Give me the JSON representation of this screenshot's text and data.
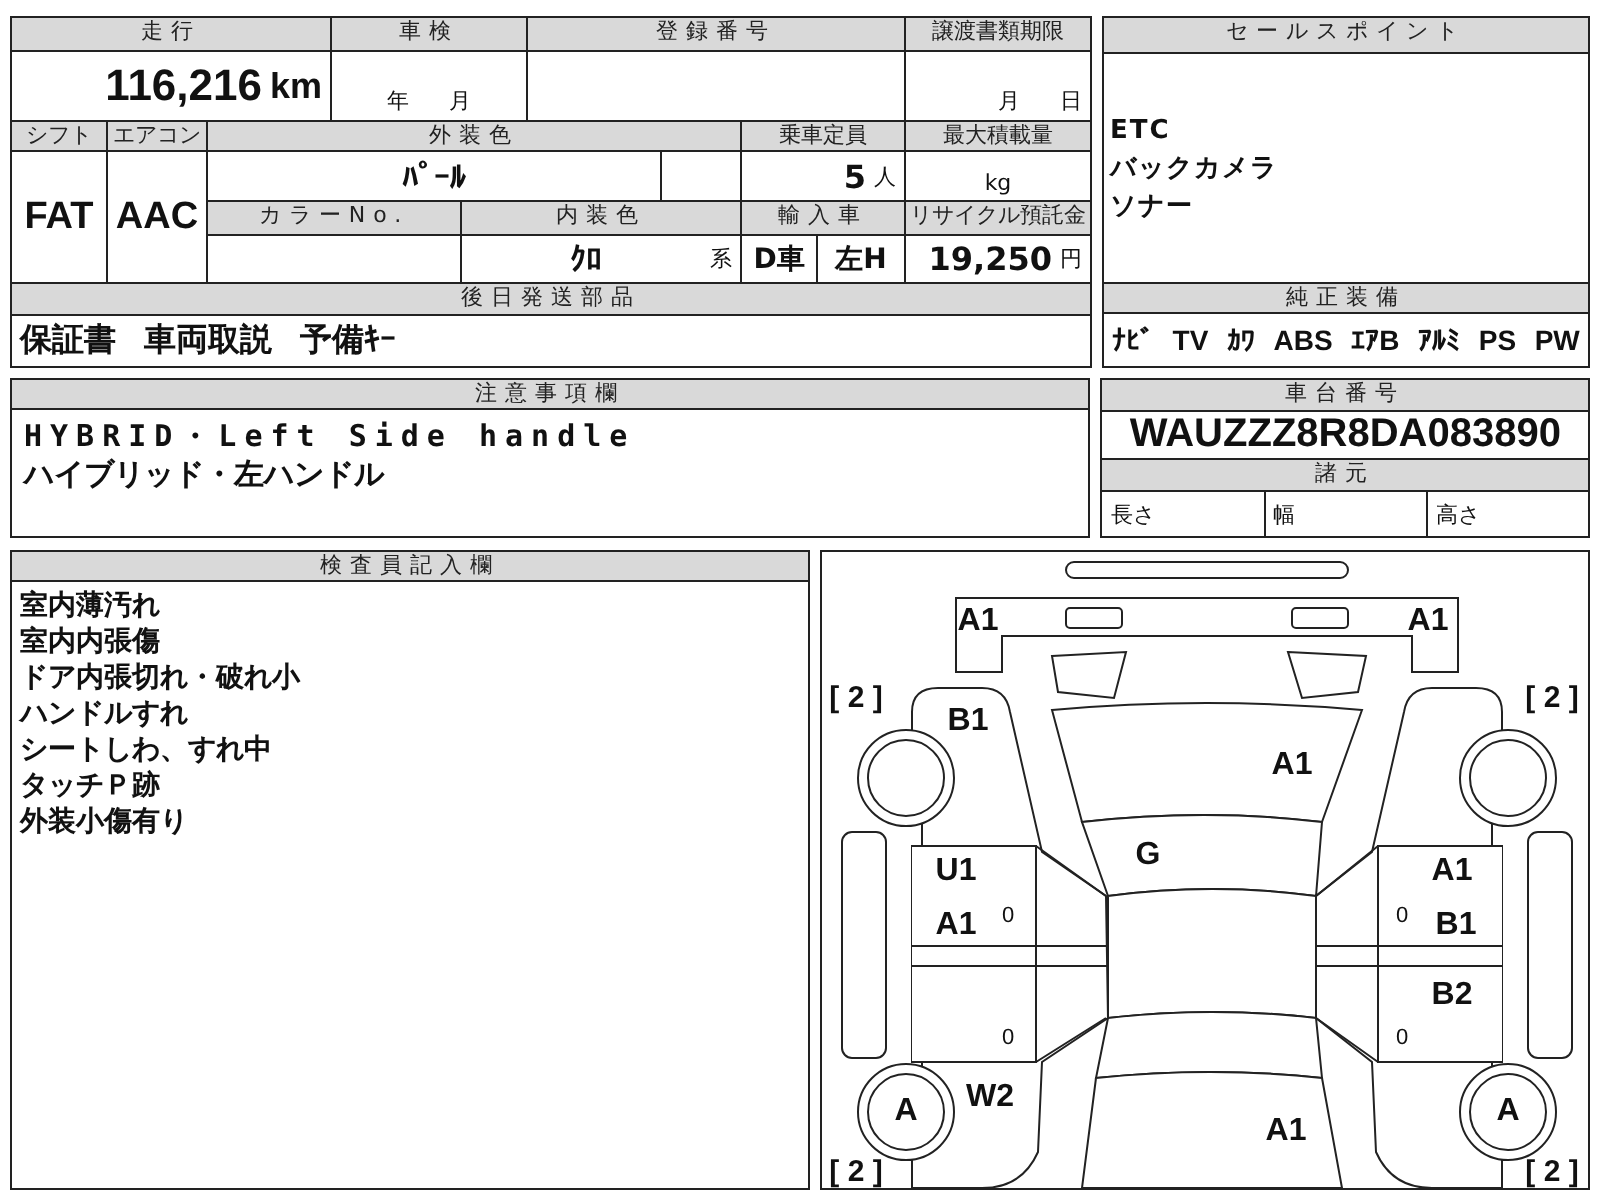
{
  "vehicle_table": {
    "mileage": {
      "label": "走行",
      "value": "116,216",
      "unit": "km"
    },
    "inspection": {
      "label": "車検",
      "units": [
        "年",
        "月"
      ]
    },
    "registration_number": {
      "label": "登録番号"
    },
    "transfer_deadline": {
      "label": "譲渡書類期限",
      "units": [
        "月",
        "日"
      ]
    },
    "shift": {
      "label": "シフト",
      "value": "FAT"
    },
    "air_conditioner": {
      "label": "エアコン",
      "value": "AAC"
    },
    "exterior_color": {
      "label": "外装色",
      "value": "ﾊﾟｰﾙ"
    },
    "capacity": {
      "label": "乗車定員",
      "value": "5",
      "unit": "人"
    },
    "max_load": {
      "label": "最大積載量",
      "unit": "kg"
    },
    "color_number": {
      "label": "カラーNo."
    },
    "interior_color": {
      "label": "内装色",
      "value": "ｸﾛ",
      "unit": "系"
    },
    "import": {
      "label": "輸入車",
      "values": [
        "D車",
        "左H"
      ]
    },
    "recycle_fee": {
      "label": "リサイクル預託金",
      "value": "19,250",
      "unit": "円"
    },
    "parts_later": {
      "label": "後日発送部品",
      "items": [
        "保証書",
        "車両取説",
        "予備ｷｰ"
      ]
    }
  },
  "sale_points": {
    "label": "セールスポイント",
    "items": [
      "ETC",
      "バックカメラ",
      "ソナー"
    ]
  },
  "standard_equipment": {
    "label": "純正装備",
    "items": [
      "ﾅﾋﾞ",
      "TV",
      "ｶﾜ",
      "ABS",
      "ｴｱB",
      "ｱﾙﾐ",
      "PS",
      "PW"
    ]
  },
  "notes": {
    "label": "注意事項欄",
    "lines": [
      "HYBRID・Left Side handle",
      "ハイブリッド・左ハンドル"
    ]
  },
  "chassis": {
    "label": "車台番号",
    "value": "WAUZZZ8R8DA083890"
  },
  "specs": {
    "label": "諸元",
    "fields": [
      "長さ",
      "幅",
      "高さ"
    ]
  },
  "inspector": {
    "label": "検査員記入欄",
    "lines": [
      "室内薄汚れ",
      "室内内張傷",
      "ドア内張切れ・破れ小",
      "ハンドルすれ",
      "シートしわ、すれ中",
      "タッチＰ跡",
      "外装小傷有り"
    ]
  },
  "diagram": {
    "damage_marks": [
      "A1",
      "A1",
      "B1",
      "A1",
      "G",
      "U1",
      "A1",
      "A1",
      "B1",
      "B2",
      "W2",
      "A1"
    ],
    "wheel_grades": [
      "A",
      "A"
    ],
    "tire_grades": [
      "[ 2 ]",
      "[ 2 ]",
      "[ 2 ]",
      "[ 2 ]"
    ],
    "door_marks": [
      "0",
      "0",
      "0",
      "0"
    ]
  }
}
